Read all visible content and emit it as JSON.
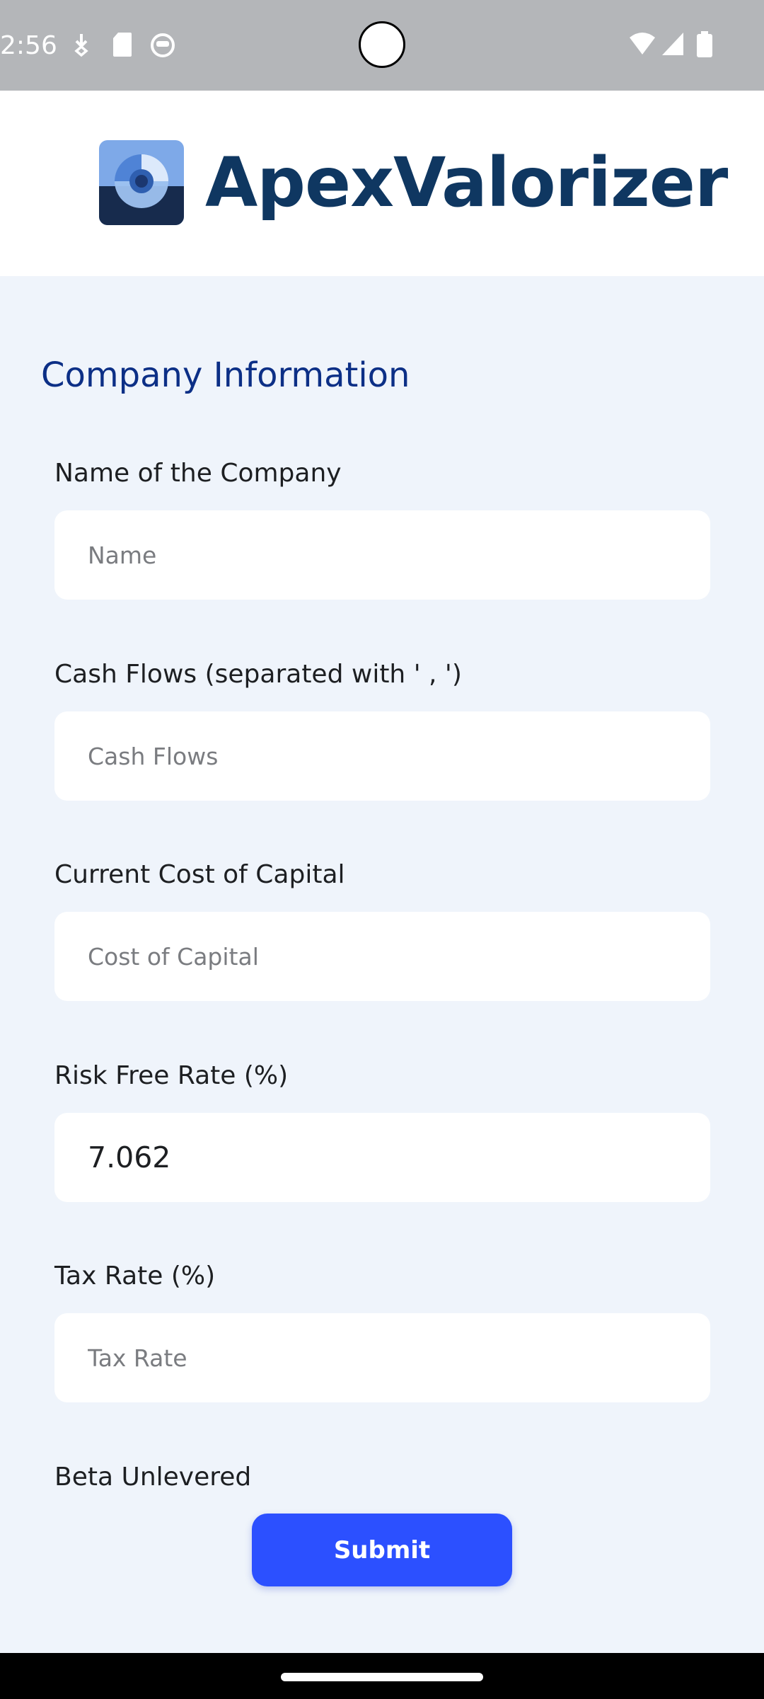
{
  "status_bar": {
    "time": "2:56",
    "left_icons": [
      "download-icon",
      "sd-card-icon",
      "face-icon"
    ],
    "right_icons": [
      "wifi-icon",
      "signal-icon",
      "battery-icon"
    ]
  },
  "header": {
    "app_name": "ApexValorizer",
    "logo_icon": "apexvalorizer-logo-icon",
    "brand_color": "#0f3761"
  },
  "form": {
    "section_title": "Company Information",
    "fields": [
      {
        "label": "Name of the Company",
        "value": "",
        "placeholder": "Name"
      },
      {
        "label": "Cash Flows (separated with ' , ')",
        "value": "",
        "placeholder": "Cash Flows"
      },
      {
        "label": "Current Cost of Capital",
        "value": "",
        "placeholder": "Cost of Capital"
      },
      {
        "label": "Risk Free Rate (%)",
        "value": "7.062",
        "placeholder": ""
      },
      {
        "label": "Tax Rate (%)",
        "value": "",
        "placeholder": "Tax Rate"
      },
      {
        "label": "Beta Unlevered"
      }
    ],
    "submit_label": "Submit",
    "accent_color": "#2c50ff"
  }
}
